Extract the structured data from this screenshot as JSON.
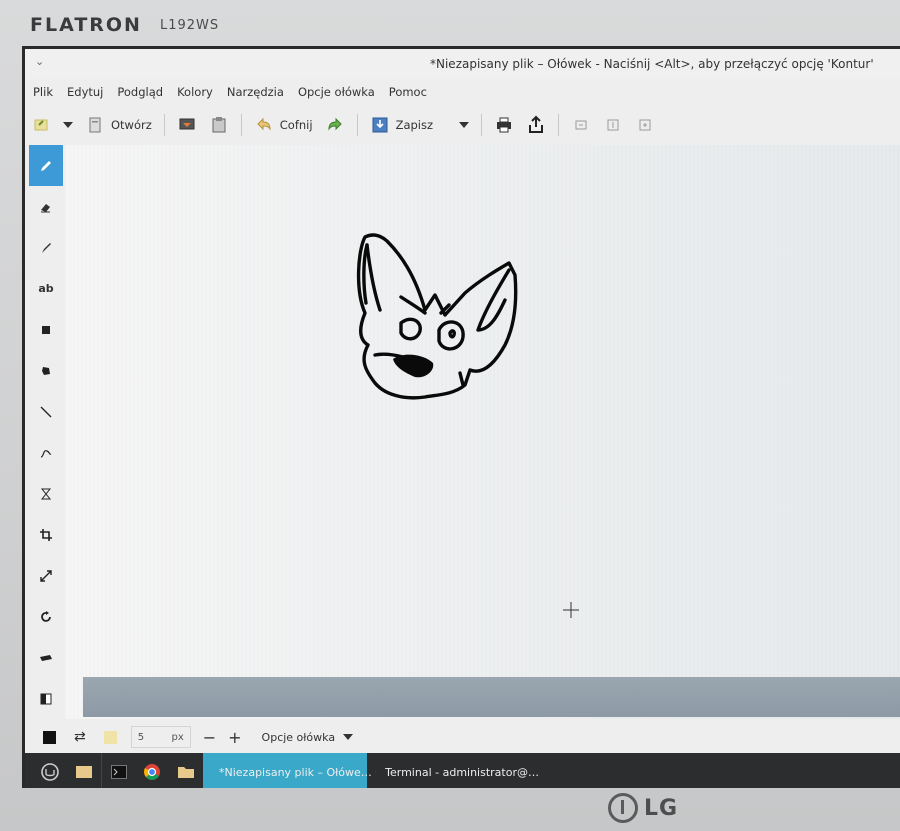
{
  "monitor": {
    "brand": "FLATRON",
    "model": "L192WS",
    "logo_text": "LG"
  },
  "window": {
    "title": "*Niezapisany plik – Ołówek - Naciśnij <Alt>, aby przełączyć opcję 'Kontur'",
    "collapse_glyph": "⌄"
  },
  "menu": [
    "Plik",
    "Edytuj",
    "Podgląd",
    "Kolory",
    "Narzędzia",
    "Opcje ołówka",
    "Pomoc"
  ],
  "toolbar": {
    "open_label": "Otwórz",
    "undo_label": "Cofnij",
    "save_label": "Zapisz"
  },
  "tools": [
    {
      "name": "pencil-tool",
      "icon": "pencil-icon",
      "active": true
    },
    {
      "name": "eraser-tool",
      "icon": "eraser-icon"
    },
    {
      "name": "brush-tool",
      "icon": "brush-icon"
    },
    {
      "name": "text-tool",
      "icon": "text-icon",
      "label": "ab"
    },
    {
      "name": "rectangle-tool",
      "icon": "square-icon"
    },
    {
      "name": "shape-tool",
      "icon": "polygon-icon"
    },
    {
      "name": "line-tool",
      "icon": "line-icon"
    },
    {
      "name": "curve-tool",
      "icon": "curve-icon"
    },
    {
      "name": "selection-tool",
      "icon": "hourglass-icon"
    },
    {
      "name": "crop-tool",
      "icon": "crop-icon"
    },
    {
      "name": "scale-tool",
      "icon": "expand-icon"
    },
    {
      "name": "rotate-tool",
      "icon": "rotate-icon"
    },
    {
      "name": "skew-tool",
      "icon": "skew-icon"
    },
    {
      "name": "filters-tool",
      "icon": "contrast-icon"
    }
  ],
  "options": {
    "size_value": "5",
    "size_unit": "px",
    "minus": "−",
    "plus": "+",
    "menu_label": "Opcje ołówka"
  },
  "taskbar": {
    "active_window": "*Niezapisany plik – Ołówe…",
    "other_window": "Terminal - administrator@…"
  },
  "colors": {
    "accent": "#3d9ad6",
    "taskbar": "#2b2d2f",
    "active_task": "#3aa8c8"
  }
}
